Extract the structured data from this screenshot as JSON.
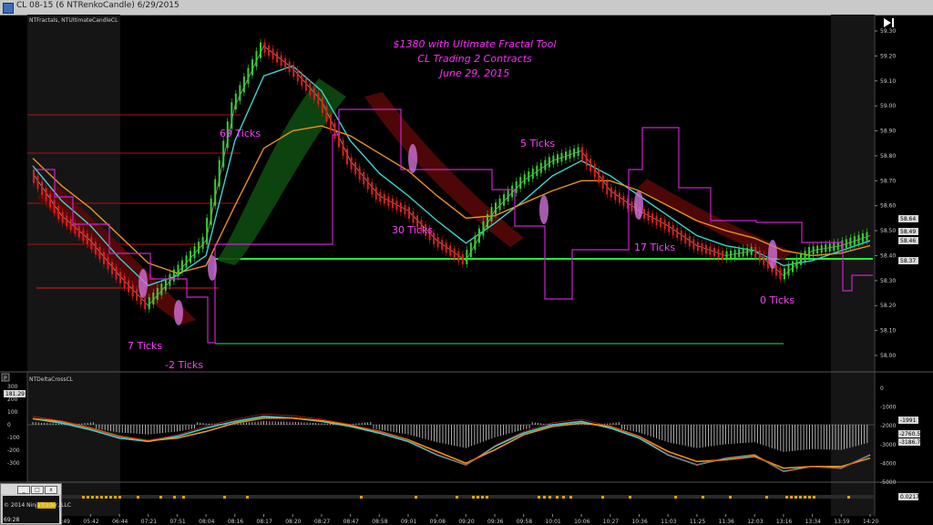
{
  "window": {
    "title": "CL 08-15 (6 NTRenkoCandle)  6/29/2015"
  },
  "main_panel": {
    "indicator_label": "NTFractals, NTUltimateCandleCL"
  },
  "lower_panel": {
    "indicator_label": "NTDeltaCrossCL",
    "marker_label": "P"
  },
  "bottom_panel": {
    "marker_label": "S"
  },
  "annotations": {
    "title_lines": [
      "$1380 with Ultimate Fractal Tool",
      "CL Trading 2 Contracts",
      "June 29, 2015"
    ],
    "labels": [
      "69 Ticks",
      "5 Ticks",
      "30 Ticks",
      "17 Ticks",
      "7 Ticks",
      "-2 Ticks",
      "0 Ticks"
    ]
  },
  "price_tags": [
    "58.64",
    "58.49",
    "58.46",
    "58.37"
  ],
  "oscillator_tags": [
    "181.29",
    "-1991",
    "-2760.52",
    "-3186.78"
  ],
  "bottom_tag": "0.0217",
  "mini_window": {
    "label": "© 2014 NinjaTrader, LLC",
    "value": "69:28"
  },
  "colors": {
    "title_text": "#ff2bff",
    "tick_labels": "#ff3dff",
    "bull_bar": "#35d12e",
    "bear_bar": "#e11d1d",
    "neutral_bar": "#e3c01b",
    "fast_ma": "#38d4d4",
    "slow_ma": "#e8921a",
    "stop_line": "#cc22cc",
    "support_line": "#27e83b",
    "resistance_line": "#b01010",
    "bull_cloud": "#0d4a10",
    "bear_cloud": "#5a0808",
    "histogram": "#bfbfbf",
    "volume_dots": "#e0a400"
  },
  "chart_data": [
    {
      "type": "line",
      "title": "CL 08-15 (6 NTRenkoCandle) 6/29/2015",
      "x": [
        "04:19",
        "04:49",
        "05:42",
        "06:44",
        "07:21",
        "07:51",
        "08:04",
        "08:16",
        "08:17",
        "08:20",
        "08:27",
        "08:47",
        "08:58",
        "09:01",
        "09:08",
        "09:20",
        "09:36",
        "09:58",
        "10:01",
        "10:06",
        "10:27",
        "10:36",
        "11:03",
        "11:25",
        "11:36",
        "12:03",
        "13:16",
        "13:34",
        "13:59",
        "14:20"
      ],
      "series": [
        {
          "values": [
            58.73,
            58.56,
            58.46,
            58.32,
            58.2,
            58.33,
            58.46,
            59.0,
            59.24,
            59.15,
            59.02,
            58.78,
            58.64,
            58.58,
            58.46,
            58.38,
            58.58,
            58.7,
            58.78,
            58.82,
            58.66,
            58.58,
            58.52,
            58.44,
            58.4,
            58.42,
            58.32,
            58.42,
            58.44,
            58.48
          ]
        },
        {
          "values": [
            58.76,
            58.62,
            58.52,
            58.39,
            58.28,
            58.32,
            58.4,
            58.86,
            59.12,
            59.16,
            59.06,
            58.86,
            58.73,
            58.64,
            58.54,
            58.45,
            58.53,
            58.62,
            58.72,
            58.78,
            58.72,
            58.64,
            58.56,
            58.48,
            58.44,
            58.42,
            58.36,
            58.38,
            58.42,
            58.46
          ]
        },
        {
          "values": [
            58.79,
            58.68,
            58.59,
            58.48,
            58.37,
            58.33,
            58.36,
            58.6,
            58.83,
            58.9,
            58.92,
            58.88,
            58.81,
            58.74,
            58.64,
            58.55,
            58.56,
            58.61,
            58.66,
            58.7,
            58.7,
            58.66,
            58.6,
            58.54,
            58.5,
            58.47,
            58.42,
            58.4,
            58.41,
            58.44
          ]
        }
      ],
      "ylim": [
        58.0,
        59.3
      ],
      "yticks": [
        58.0,
        58.1,
        58.2,
        58.3,
        58.4,
        58.5,
        58.6,
        58.7,
        58.8,
        58.9,
        59.0,
        59.1,
        59.2,
        59.3
      ],
      "grid": false
    },
    {
      "type": "line",
      "title": "NTDeltaCrossCL",
      "x": [
        "04:19",
        "04:49",
        "05:42",
        "06:44",
        "07:21",
        "07:51",
        "08:04",
        "08:16",
        "08:17",
        "08:20",
        "08:27",
        "08:47",
        "08:58",
        "09:01",
        "09:08",
        "09:20",
        "09:36",
        "09:58",
        "10:01",
        "10:06",
        "10:27",
        "10:36",
        "11:03",
        "11:25",
        "11:36",
        "12:03",
        "13:16",
        "13:34",
        "13:59",
        "14:20"
      ],
      "series": [
        {
          "values": [
            181,
            50,
            -150,
            -400,
            -500,
            -350,
            -100,
            100,
            250,
            200,
            100,
            -50,
            -250,
            -500,
            -900,
            -1200,
            -650,
            -250,
            0,
            100,
            -100,
            -400,
            -900,
            -1200,
            -1000,
            -900,
            -1400,
            -1250,
            -1300,
            -900
          ]
        },
        {
          "values": [
            180,
            100,
            -100,
            -350,
            -480,
            -400,
            -200,
            50,
            200,
            200,
            120,
            -20,
            -200,
            -450,
            -800,
            -1150,
            -750,
            -300,
            -50,
            50,
            -50,
            -350,
            -800,
            -1100,
            -1050,
            -950,
            -1300,
            -1250,
            -1250,
            -1000
          ]
        }
      ],
      "right_axis_ticks": [
        0,
        -1000,
        -2000,
        -3000,
        -4000,
        -5000
      ],
      "left_axis_ticks": [
        300,
        200,
        100,
        0,
        -100,
        -200,
        -300
      ]
    }
  ],
  "axis": {
    "x_labels": [
      "04:19",
      "04:49",
      "05:42",
      "06:44",
      "07:21",
      "07:51",
      "08:04",
      "08:16",
      "08:17",
      "08:20",
      "08:27",
      "08:47",
      "08:58",
      "09:01",
      "09:08",
      "09:20",
      "09:36",
      "09:58",
      "10:01",
      "10:06",
      "10:27",
      "10:36",
      "11:03",
      "11:25",
      "11:36",
      "12:03",
      "13:16",
      "13:34",
      "13:59",
      "14:20"
    ],
    "price_ticks": [
      "59.30",
      "59.20",
      "59.10",
      "59.00",
      "58.90",
      "58.80",
      "58.70",
      "58.60",
      "58.50",
      "58.40",
      "58.30",
      "58.20",
      "58.10",
      "58.00"
    ],
    "osc_right_ticks": [
      "0",
      "-1000",
      "-2000",
      "-3000",
      "-4000",
      "-5000"
    ],
    "osc_left_ticks": [
      "300",
      "200",
      "100",
      "0",
      "-100",
      "-200",
      "-300"
    ]
  }
}
